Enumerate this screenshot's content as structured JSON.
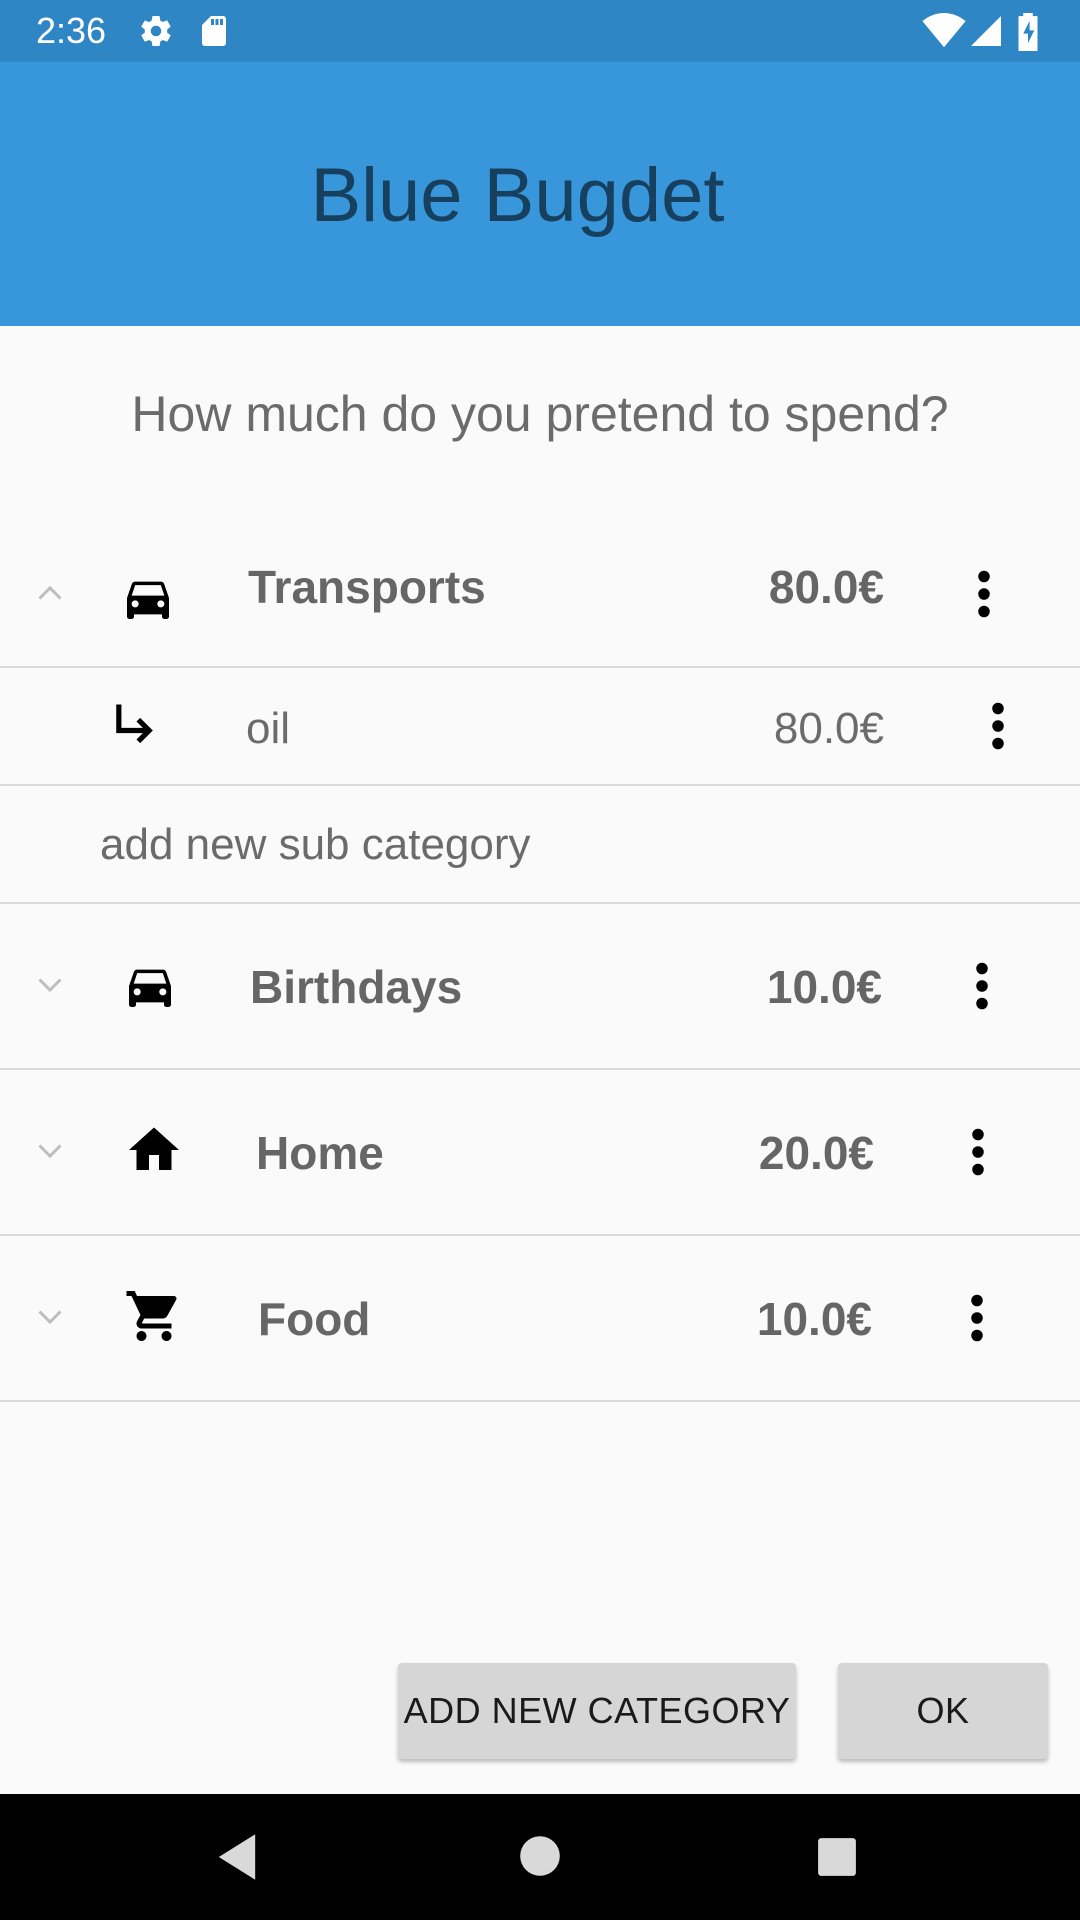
{
  "status_bar": {
    "time": "2:36",
    "icons": [
      "settings-icon",
      "sd-card-icon",
      "wifi-icon",
      "signal-icon",
      "battery-charging-icon"
    ]
  },
  "app_bar": {
    "title": "Blue Bugdet"
  },
  "prompt": "How much do you pretend to spend?",
  "categories": [
    {
      "name": "Transports",
      "amount": "80.0€",
      "icon": "car-icon",
      "expanded": true,
      "subcategories": [
        {
          "name": "oil",
          "amount": "80.0€",
          "icon": "subdirectory-arrow-icon"
        }
      ],
      "add_sub_label": "add new sub category"
    },
    {
      "name": "Birthdays",
      "amount": "10.0€",
      "icon": "car-icon",
      "expanded": false
    },
    {
      "name": "Home",
      "amount": "20.0€",
      "icon": "home-icon",
      "expanded": false
    },
    {
      "name": "Food",
      "amount": "10.0€",
      "icon": "shopping-cart-icon",
      "expanded": false
    }
  ],
  "buttons": {
    "add_category": "ADD NEW CATEGORY",
    "ok": "OK"
  },
  "colors": {
    "status_bar": "#2e86c5",
    "app_bar": "#3897db",
    "title_text": "#173f5e",
    "background": "#fafafa"
  }
}
